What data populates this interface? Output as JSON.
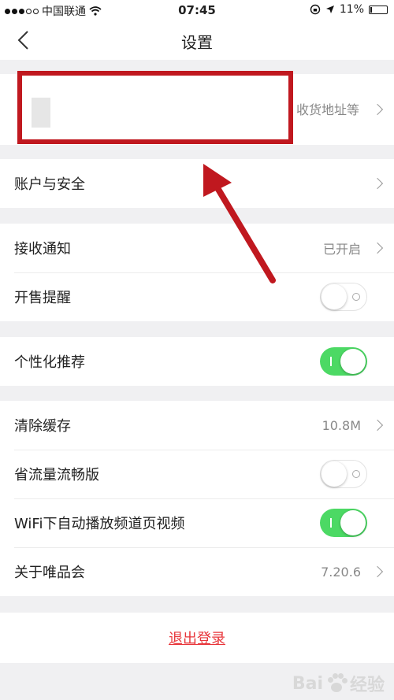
{
  "status_bar": {
    "carrier": "中国联通",
    "time": "07:45",
    "battery": "11%",
    "battery_level": 0.11
  },
  "nav": {
    "title": "设置"
  },
  "profile": {
    "subtitle": "收货地址等"
  },
  "sections": {
    "account": {
      "label": "账户与安全"
    },
    "notify": {
      "label": "接收通知",
      "value": "已开启"
    },
    "sale_remind": {
      "label": "开售提醒",
      "enabled": false
    },
    "personalized": {
      "label": "个性化推荐",
      "enabled": true
    },
    "clear_cache": {
      "label": "清除缓存",
      "value": "10.8M"
    },
    "data_saver": {
      "label": "省流量流畅版",
      "enabled": false
    },
    "wifi_autoplay": {
      "label": "WiFi下自动播放频道页视频",
      "enabled": true
    },
    "about": {
      "label": "关于唯品会",
      "value": "7.20.6"
    }
  },
  "logout": {
    "label": "退出登录"
  },
  "watermark": {
    "text": "Bai",
    "suffix": "经验"
  },
  "colors": {
    "accent_red": "#e8353a",
    "annotation_red": "#c0181f",
    "toggle_green": "#4cd964"
  }
}
